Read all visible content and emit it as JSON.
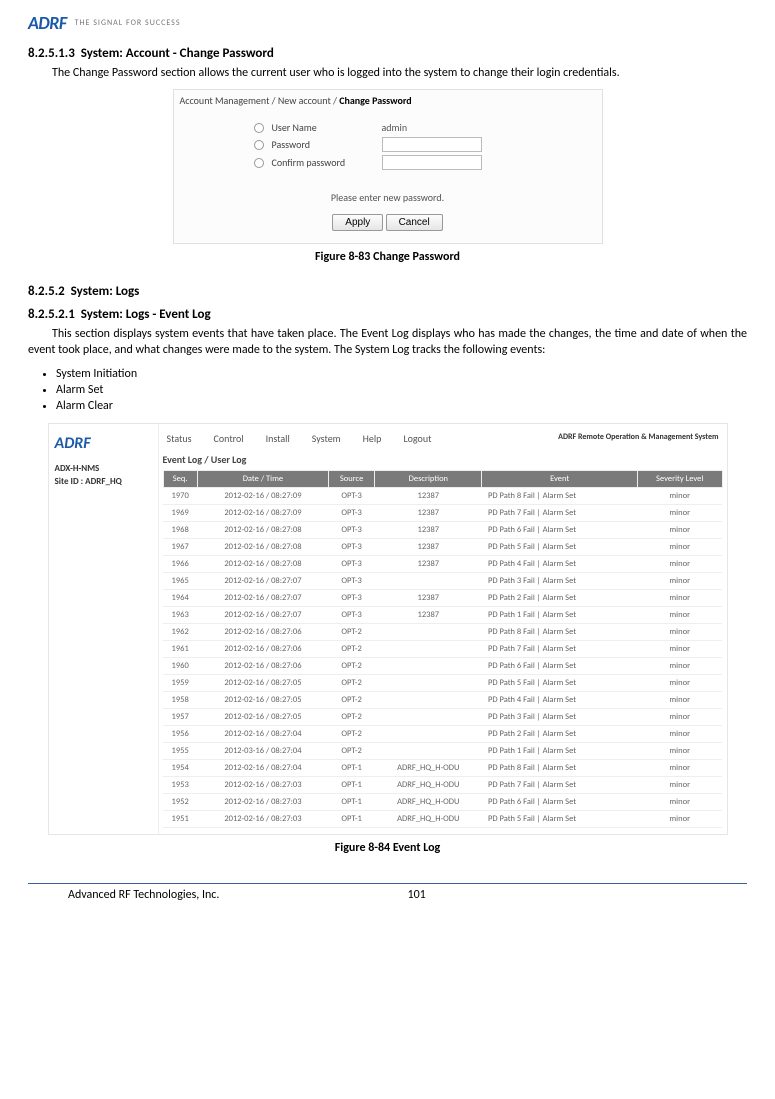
{
  "logo": {
    "brand": "ADRF",
    "tagline": "THE SIGNAL FOR SUCCESS"
  },
  "sec1": {
    "num": "8.2.5.1.3",
    "title": "System: Account - Change Password",
    "body": "The Change Password section allows the current user who is logged into the system to change their login credentials."
  },
  "panel_change": {
    "breadcrumb": {
      "a": "Account Management",
      "b": "New account",
      "c": "Change Password"
    },
    "rows": [
      {
        "label": "User Name",
        "value": "admin",
        "type": "text"
      },
      {
        "label": "Password",
        "value": "",
        "type": "password"
      },
      {
        "label": "Confirm password",
        "value": "",
        "type": "password"
      }
    ],
    "instruction": "Please enter new password.",
    "buttons": {
      "apply": "Apply",
      "cancel": "Cancel"
    }
  },
  "fig83": "Figure 8-83   Change Password",
  "sec2": {
    "num": "8.2.5.2",
    "title": "System: Logs"
  },
  "sec3": {
    "num": "8.2.5.2.1",
    "title": "System: Logs - Event Log",
    "body": "This section displays system events that have taken place. The Event Log displays who has made the changes, the time and date of when the event took place, and what changes were made to the system. The System Log tracks the following events:",
    "bullets": [
      "System Initiation",
      "Alarm Set",
      "Alarm Clear"
    ]
  },
  "panel_log": {
    "side": {
      "brand": "ADRF",
      "line1": "ADX-H-NMS",
      "line2": "Site ID : ADRF_HQ"
    },
    "nav": [
      "Status",
      "Control",
      "Install",
      "System",
      "Help",
      "Logout"
    ],
    "remote": "ADRF Remote Operation & Management System",
    "subnav": "Event Log / User Log",
    "cols": [
      "Seq.",
      "Date / Time",
      "Source",
      "Description",
      "Event",
      "Severity Level"
    ],
    "rows": [
      {
        "seq": "1970",
        "dt": "2012-02-16 / 08:27:09",
        "src": "OPT-3",
        "desc": "12387",
        "evt": "PD Path 8 Fail | Alarm Set",
        "sev": "minor"
      },
      {
        "seq": "1969",
        "dt": "2012-02-16 / 08:27:09",
        "src": "OPT-3",
        "desc": "12387",
        "evt": "PD Path 7 Fail | Alarm Set",
        "sev": "minor"
      },
      {
        "seq": "1968",
        "dt": "2012-02-16 / 08:27:08",
        "src": "OPT-3",
        "desc": "12387",
        "evt": "PD Path 6 Fail | Alarm Set",
        "sev": "minor"
      },
      {
        "seq": "1967",
        "dt": "2012-02-16 / 08:27:08",
        "src": "OPT-3",
        "desc": "12387",
        "evt": "PD Path 5 Fail | Alarm Set",
        "sev": "minor"
      },
      {
        "seq": "1966",
        "dt": "2012-02-16 / 08:27:08",
        "src": "OPT-3",
        "desc": "12387",
        "evt": "PD Path 4 Fail | Alarm Set",
        "sev": "minor"
      },
      {
        "seq": "1965",
        "dt": "2012-02-16 / 08:27:07",
        "src": "OPT-3",
        "desc": "",
        "evt": "PD Path 3 Fail | Alarm Set",
        "sev": "minor"
      },
      {
        "seq": "1964",
        "dt": "2012-02-16 / 08:27:07",
        "src": "OPT-3",
        "desc": "12387",
        "evt": "PD Path 2 Fail | Alarm Set",
        "sev": "minor"
      },
      {
        "seq": "1963",
        "dt": "2012-02-16 / 08:27:07",
        "src": "OPT-3",
        "desc": "12387",
        "evt": "PD Path 1 Fail | Alarm Set",
        "sev": "minor"
      },
      {
        "seq": "1962",
        "dt": "2012-02-16 / 08:27:06",
        "src": "OPT-2",
        "desc": "",
        "evt": "PD Path 8 Fail | Alarm Set",
        "sev": "minor"
      },
      {
        "seq": "1961",
        "dt": "2012-02-16 / 08:27:06",
        "src": "OPT-2",
        "desc": "",
        "evt": "PD Path 7 Fail | Alarm Set",
        "sev": "minor"
      },
      {
        "seq": "1960",
        "dt": "2012-02-16 / 08:27:06",
        "src": "OPT-2",
        "desc": "",
        "evt": "PD Path 6 Fail | Alarm Set",
        "sev": "minor"
      },
      {
        "seq": "1959",
        "dt": "2012-02-16 / 08:27:05",
        "src": "OPT-2",
        "desc": "",
        "evt": "PD Path 5 Fail | Alarm Set",
        "sev": "minor"
      },
      {
        "seq": "1958",
        "dt": "2012-02-16 / 08:27:05",
        "src": "OPT-2",
        "desc": "",
        "evt": "PD Path 4 Fail | Alarm Set",
        "sev": "minor"
      },
      {
        "seq": "1957",
        "dt": "2012-02-16 / 08:27:05",
        "src": "OPT-2",
        "desc": "",
        "evt": "PD Path 3 Fail | Alarm Set",
        "sev": "minor"
      },
      {
        "seq": "1956",
        "dt": "2012-02-16 / 08:27:04",
        "src": "OPT-2",
        "desc": "",
        "evt": "PD Path 2 Fail | Alarm Set",
        "sev": "minor"
      },
      {
        "seq": "1955",
        "dt": "2012-03-16 / 08:27:04",
        "src": "OPT-2",
        "desc": "",
        "evt": "PD Path 1 Fail | Alarm Set",
        "sev": "minor"
      },
      {
        "seq": "1954",
        "dt": "2012-02-16 / 08:27:04",
        "src": "OPT-1",
        "desc": "ADRF_HQ_H-ODU",
        "evt": "PD Path 8 Fail | Alarm Set",
        "sev": "minor"
      },
      {
        "seq": "1953",
        "dt": "2012-02-16 / 08:27:03",
        "src": "OPT-1",
        "desc": "ADRF_HQ_H-ODU",
        "evt": "PD Path 7 Fail | Alarm Set",
        "sev": "minor"
      },
      {
        "seq": "1952",
        "dt": "2012-02-16 / 08:27:03",
        "src": "OPT-1",
        "desc": "ADRF_HQ_H-ODU",
        "evt": "PD Path 6 Fail | Alarm Set",
        "sev": "minor"
      },
      {
        "seq": "1951",
        "dt": "2012-02-16 / 08:27:03",
        "src": "OPT-1",
        "desc": "ADRF_HQ_H-ODU",
        "evt": "PD Path 5 Fail | Alarm Set",
        "sev": "minor"
      }
    ]
  },
  "fig84": "Figure 8-84   Event Log",
  "footer": {
    "company": "Advanced RF Technologies, Inc.",
    "page": "101"
  }
}
